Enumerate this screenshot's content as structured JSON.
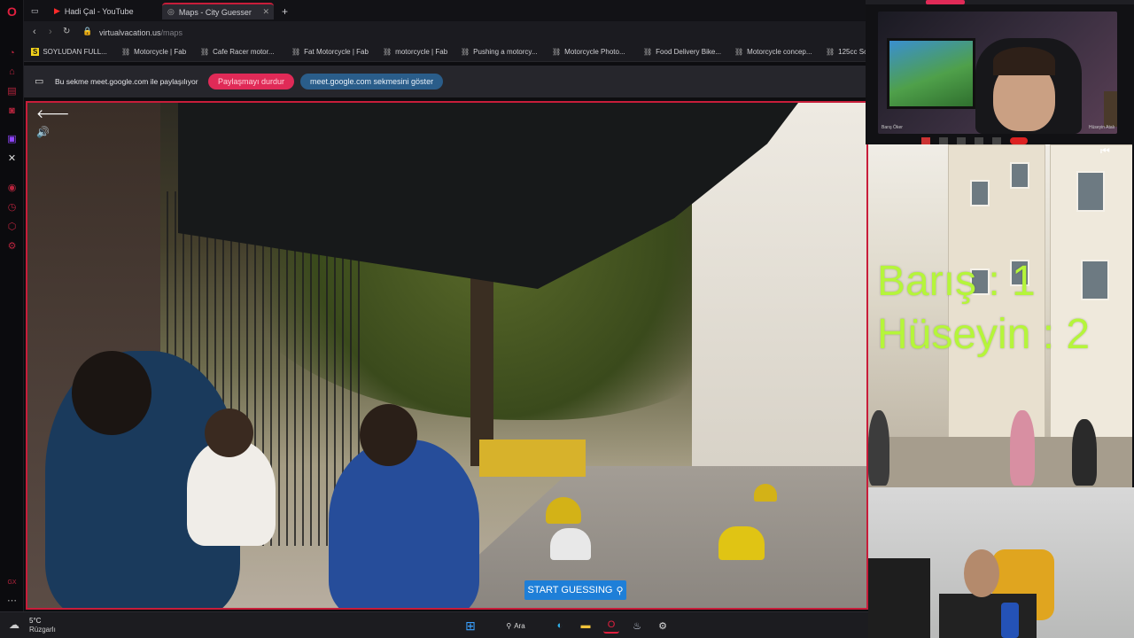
{
  "tabs": [
    {
      "label": "Hadi Çal - YouTube",
      "active": false
    },
    {
      "label": "Maps - City Guesser",
      "active": true
    }
  ],
  "address": {
    "domain": "virtualvacation.us",
    "path": "/maps"
  },
  "bookmarks": [
    {
      "label": "SOYLUDAN FULL..."
    },
    {
      "label": "Motorcycle | Fab"
    },
    {
      "label": "Cafe Racer motor..."
    },
    {
      "label": "Fat Motorcycle | Fab"
    },
    {
      "label": "motorcycle | Fab"
    },
    {
      "label": "Pushing a motorcy..."
    },
    {
      "label": "Motorcycle Photo..."
    },
    {
      "label": "Food Delivery Bike..."
    },
    {
      "label": "Motorcycle concep..."
    },
    {
      "label": "125cc Sc"
    }
  ],
  "sharebar": {
    "text": "Bu sekme meet.google.com ile paylaşılıyor",
    "stop_label": "Paylaşmayı durdur",
    "show_label": "meet.google.com sekmesini göster"
  },
  "score": {
    "line1": "Barış  : 1",
    "line2": "Hüseyin : 2"
  },
  "start_button": {
    "label": "START GUESSING"
  },
  "sidebar_badge": "GX",
  "webcam": {
    "top_name_left": "Barış Öker",
    "top_name_right": "Hüseyin Atalı"
  },
  "taskbar": {
    "temp": "5°C",
    "weather": "Rüzgarlı",
    "search_label": "Ara"
  },
  "colors": {
    "accent": "#c81d3a",
    "score": "#b5f53a",
    "start_button": "#1e7fd8",
    "sharebar_pill": "#e02a57",
    "sharebar_pill2": "#2a5d8a"
  }
}
